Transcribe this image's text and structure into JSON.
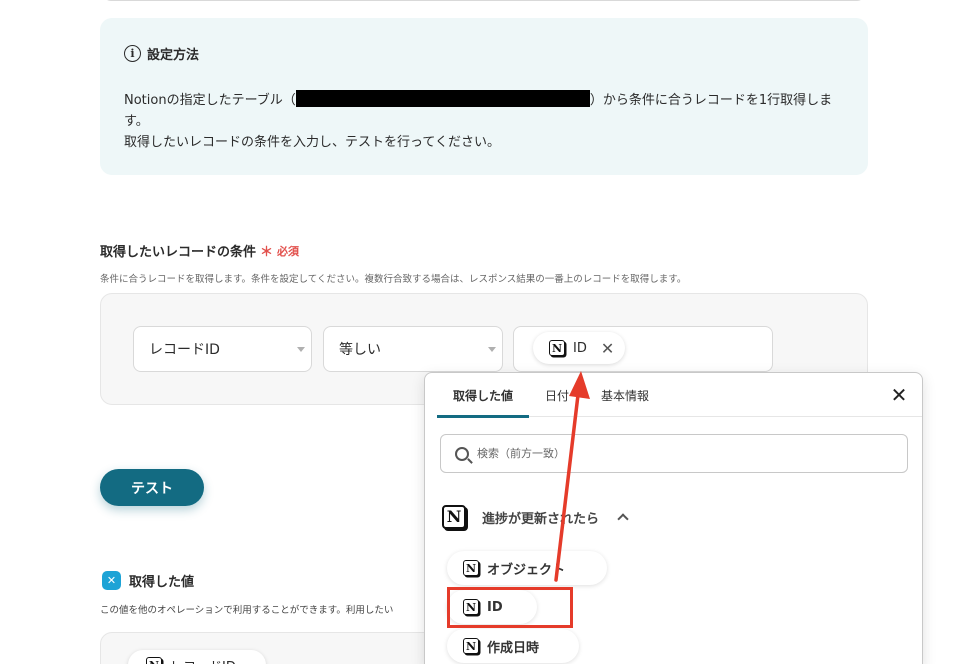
{
  "info": {
    "title": "設定方法",
    "line1_before": "Notionの指定したテーブル（",
    "line1_after": "）から条件に合うレコードを1行取得しま",
    "line2": "す。",
    "line3": "取得したいレコードの条件を入力し、テストを行ってください。"
  },
  "condition": {
    "title": "取得したいレコードの条件",
    "required_mark": "＊",
    "required_label": "必須",
    "description": "条件に合うレコードを取得します。条件を設定してください。複数行合致する場合は、レスポンス結果の一番上のレコードを取得します。",
    "field_select": "レコードID",
    "operator_select": "等しい",
    "value_chip": "ID"
  },
  "test_button": "テスト",
  "result": {
    "title": "取得した値",
    "description": "この値を他のオペレーションで利用することができます。利用したい",
    "chip": "レコードID"
  },
  "popup": {
    "tabs": [
      "取得した値",
      "日付",
      "基本情報"
    ],
    "search_placeholder": "検索（前方一致）",
    "group_label": "進捗が更新されたら",
    "items": [
      "オブジェクト",
      "ID",
      "作成日時"
    ]
  },
  "colors": {
    "accent": "#136b82",
    "required": "#e2504c",
    "annotation": "#e53b2a",
    "info_bg": "#eef7f8"
  }
}
